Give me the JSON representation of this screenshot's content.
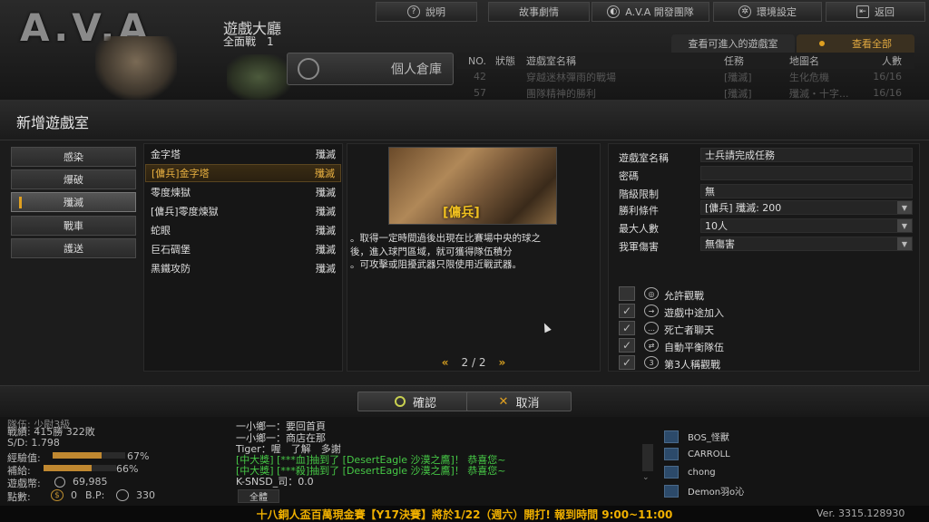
{
  "header": {
    "logo": "A.V.A",
    "lobby_title": "遊戲大廳",
    "lobby_sub": "全面戰　1",
    "nav": [
      {
        "label": "說明",
        "icon": "help-icon"
      },
      {
        "label": "故事劇情",
        "icon": ""
      },
      {
        "label": "A.V.A 開發團隊",
        "icon": "team-icon"
      },
      {
        "label": "環境設定",
        "icon": "gear-icon"
      },
      {
        "label": "返回",
        "icon": "exit-icon"
      }
    ],
    "warehouse_label": "個人倉庫",
    "tab_available": "查看可進入的遊戲室",
    "tab_all": "查看全部"
  },
  "room_list": {
    "columns": [
      "NO.",
      "狀態",
      "遊戲室名稱",
      "任務",
      "地圖名",
      "人數"
    ],
    "rows": [
      [
        "42",
        "",
        "穿越迷林彈雨的戰場",
        "[殲滅]",
        "生化危機",
        "16/16"
      ],
      [
        "57",
        "",
        "團隊精神的勝利",
        "[殲滅]",
        "殲滅・十字...",
        "16/16"
      ]
    ]
  },
  "dialog": {
    "title": "新增遊戲室",
    "modes": [
      "感染",
      "爆破",
      "殲滅",
      "戰車",
      "護送"
    ],
    "selected_mode": 2,
    "maps": [
      {
        "name": "金字塔",
        "type": "殲滅"
      },
      {
        "name": "[傭兵]金字塔",
        "type": "殲滅"
      },
      {
        "name": "零度煉獄",
        "type": "殲滅"
      },
      {
        "name": "[傭兵]零度煉獄",
        "type": "殲滅"
      },
      {
        "name": "蛇眼",
        "type": "殲滅"
      },
      {
        "name": "巨石碉堡",
        "type": "殲滅"
      },
      {
        "name": "黑鐵攻防",
        "type": "殲滅"
      }
    ],
    "selected_map": 1,
    "preview_badge": "[傭兵]",
    "description": [
      "。取得一定時間過後出現在比賽場中央的球之",
      "後，進入球門區域，就可獲得隊伍積分",
      "。可攻擊或阻擾武器只限使用近戰武器。"
    ],
    "pager": "2 / 2",
    "settings": [
      {
        "label": "遊戲室名稱",
        "value": "士兵請完成任務",
        "dropdown": false
      },
      {
        "label": "密碼",
        "value": "",
        "dropdown": false
      },
      {
        "label": "階級限制",
        "value": "無",
        "dropdown": false
      },
      {
        "label": "勝利條件",
        "value": "[傭兵] 殲滅: 200",
        "dropdown": true
      },
      {
        "label": "最大人數",
        "value": "10人",
        "dropdown": true
      },
      {
        "label": "我軍傷害",
        "value": "無傷害",
        "dropdown": true
      }
    ],
    "options": [
      {
        "label": "允許觀戰",
        "checked": false
      },
      {
        "label": "遊戲中途加入",
        "checked": true
      },
      {
        "label": "死亡者聊天",
        "checked": true
      },
      {
        "label": "自動平衡隊伍",
        "checked": true
      },
      {
        "label": "第3人稱觀戰",
        "checked": true
      }
    ],
    "ok_label": "確認",
    "cancel_label": "取消"
  },
  "stats": {
    "rank": "隊伍: 少尉3級",
    "record": "戰績: 415勝 322敗",
    "sd": "S/D: 1.798",
    "exp_label": "經驗值:",
    "exp_pct": "67%",
    "exp_value": 67,
    "supply_label": "補給:",
    "supply_pct": "66%",
    "supply_value": 66,
    "coin_label": "遊戲幣:",
    "coin_value": "69,985",
    "points_label": "點數:",
    "points_value": "0",
    "bp_label": "B.P:",
    "bp_value": "330"
  },
  "chat": {
    "lines": [
      {
        "text": "一小鄉一：要回首頁",
        "green": false
      },
      {
        "text": "一小鄉一：商店在那",
        "green": false
      },
      {
        "text": "Tiger：喔　了解　多謝",
        "green": false
      },
      {
        "text": "[中大獎] [***血]抽到了 [DesertEagle 沙漠之鷹]！ 恭喜您~",
        "green": true
      },
      {
        "text": "[中大獎] [***殺]抽到了 [DesertEagle 沙漠之鷹]！ 恭喜您~",
        "green": true
      },
      {
        "text": "K-SNSD_司：0.0",
        "green": false
      }
    ],
    "tab": "全體"
  },
  "players": [
    "BOS_怪獸",
    "CARROLL",
    "chong",
    "Demon羽o沁"
  ],
  "ticker": "十八銅人盃百萬現金賽【Y17決賽】將於1/22（週六）開打! 報到時間 9:00~11:00",
  "version": "Ver. 3315.128930"
}
